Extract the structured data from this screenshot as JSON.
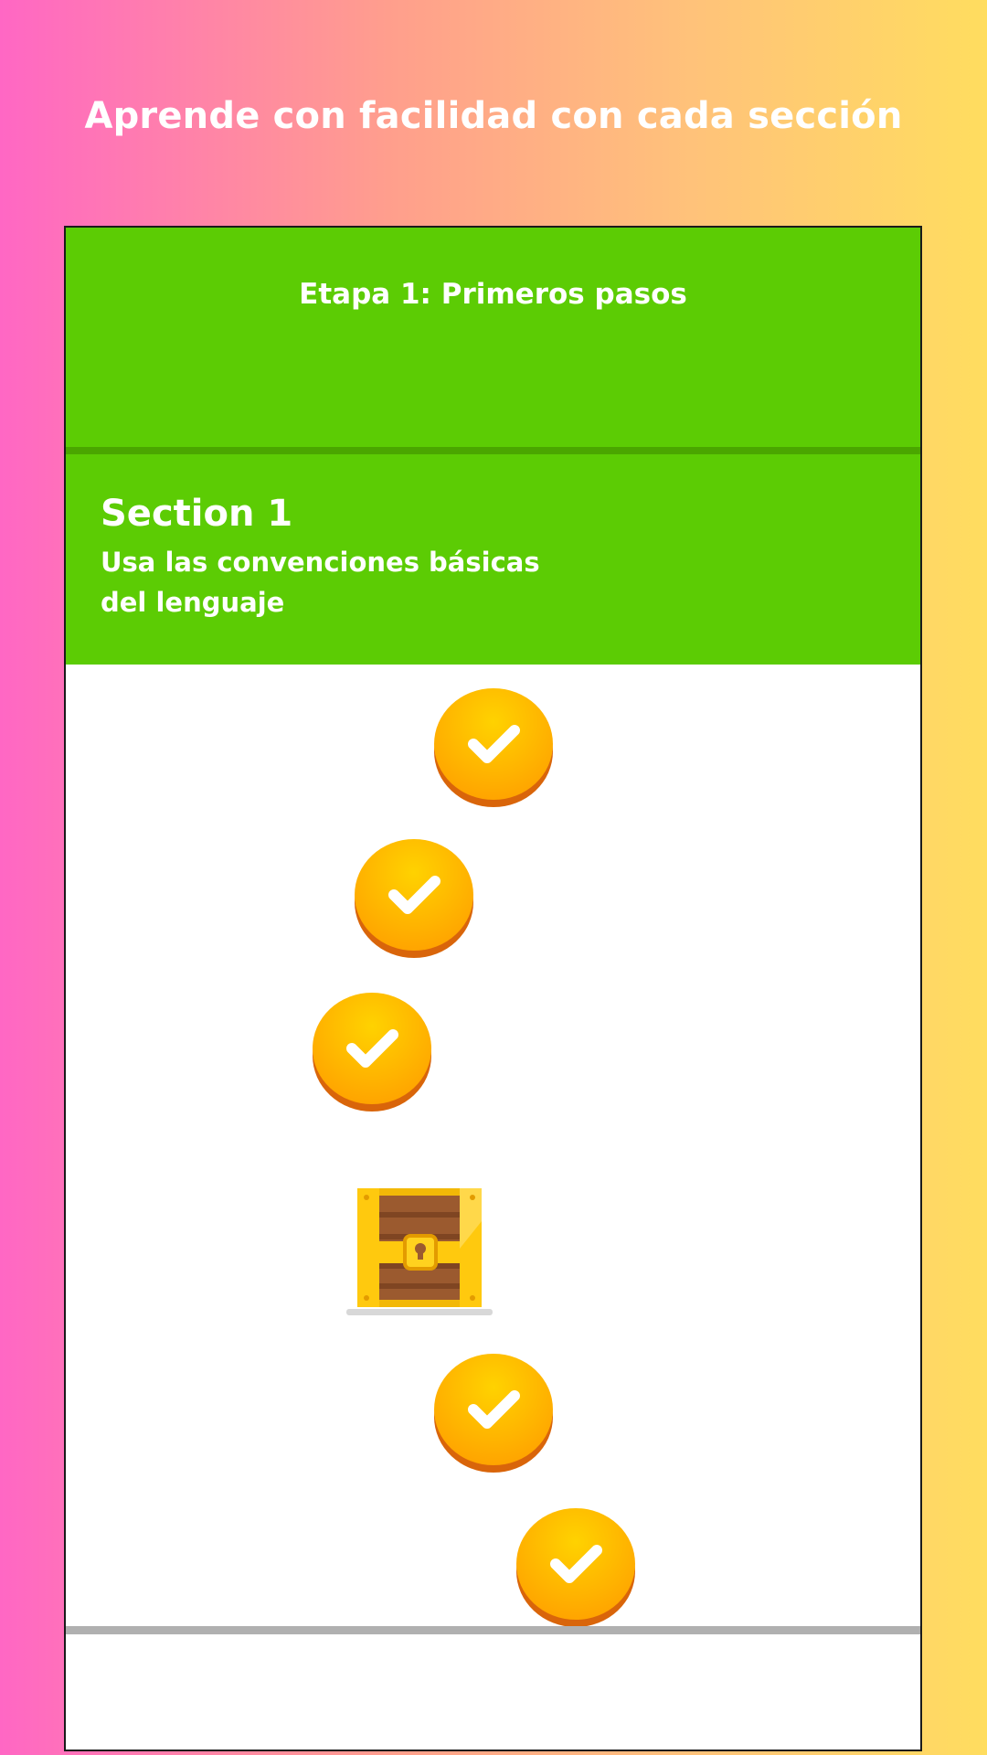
{
  "headline": "Aprende con facilidad con cada sección",
  "stage": {
    "title": "Etapa 1: Primeros pasos"
  },
  "section": {
    "title": "Section 1",
    "description_line1": "Usa las convenciones básicas",
    "description_line2": "del lenguaje"
  },
  "path": {
    "nodes": [
      {
        "type": "lesson",
        "status": "completed",
        "icon": "checkmark-icon"
      },
      {
        "type": "lesson",
        "status": "completed",
        "icon": "checkmark-icon"
      },
      {
        "type": "lesson",
        "status": "completed",
        "icon": "checkmark-icon"
      },
      {
        "type": "chest",
        "status": "locked",
        "icon": "treasure-chest-icon"
      },
      {
        "type": "lesson",
        "status": "completed",
        "icon": "checkmark-icon"
      },
      {
        "type": "lesson",
        "status": "completed",
        "icon": "checkmark-icon"
      }
    ]
  },
  "colors": {
    "green": "#5ccc04",
    "green_dark": "#4aa600",
    "coin": "#ffb300",
    "coin_shadow": "#d9650a",
    "gradient_left": "#ff67c4",
    "gradient_right": "#ffdd5f"
  }
}
